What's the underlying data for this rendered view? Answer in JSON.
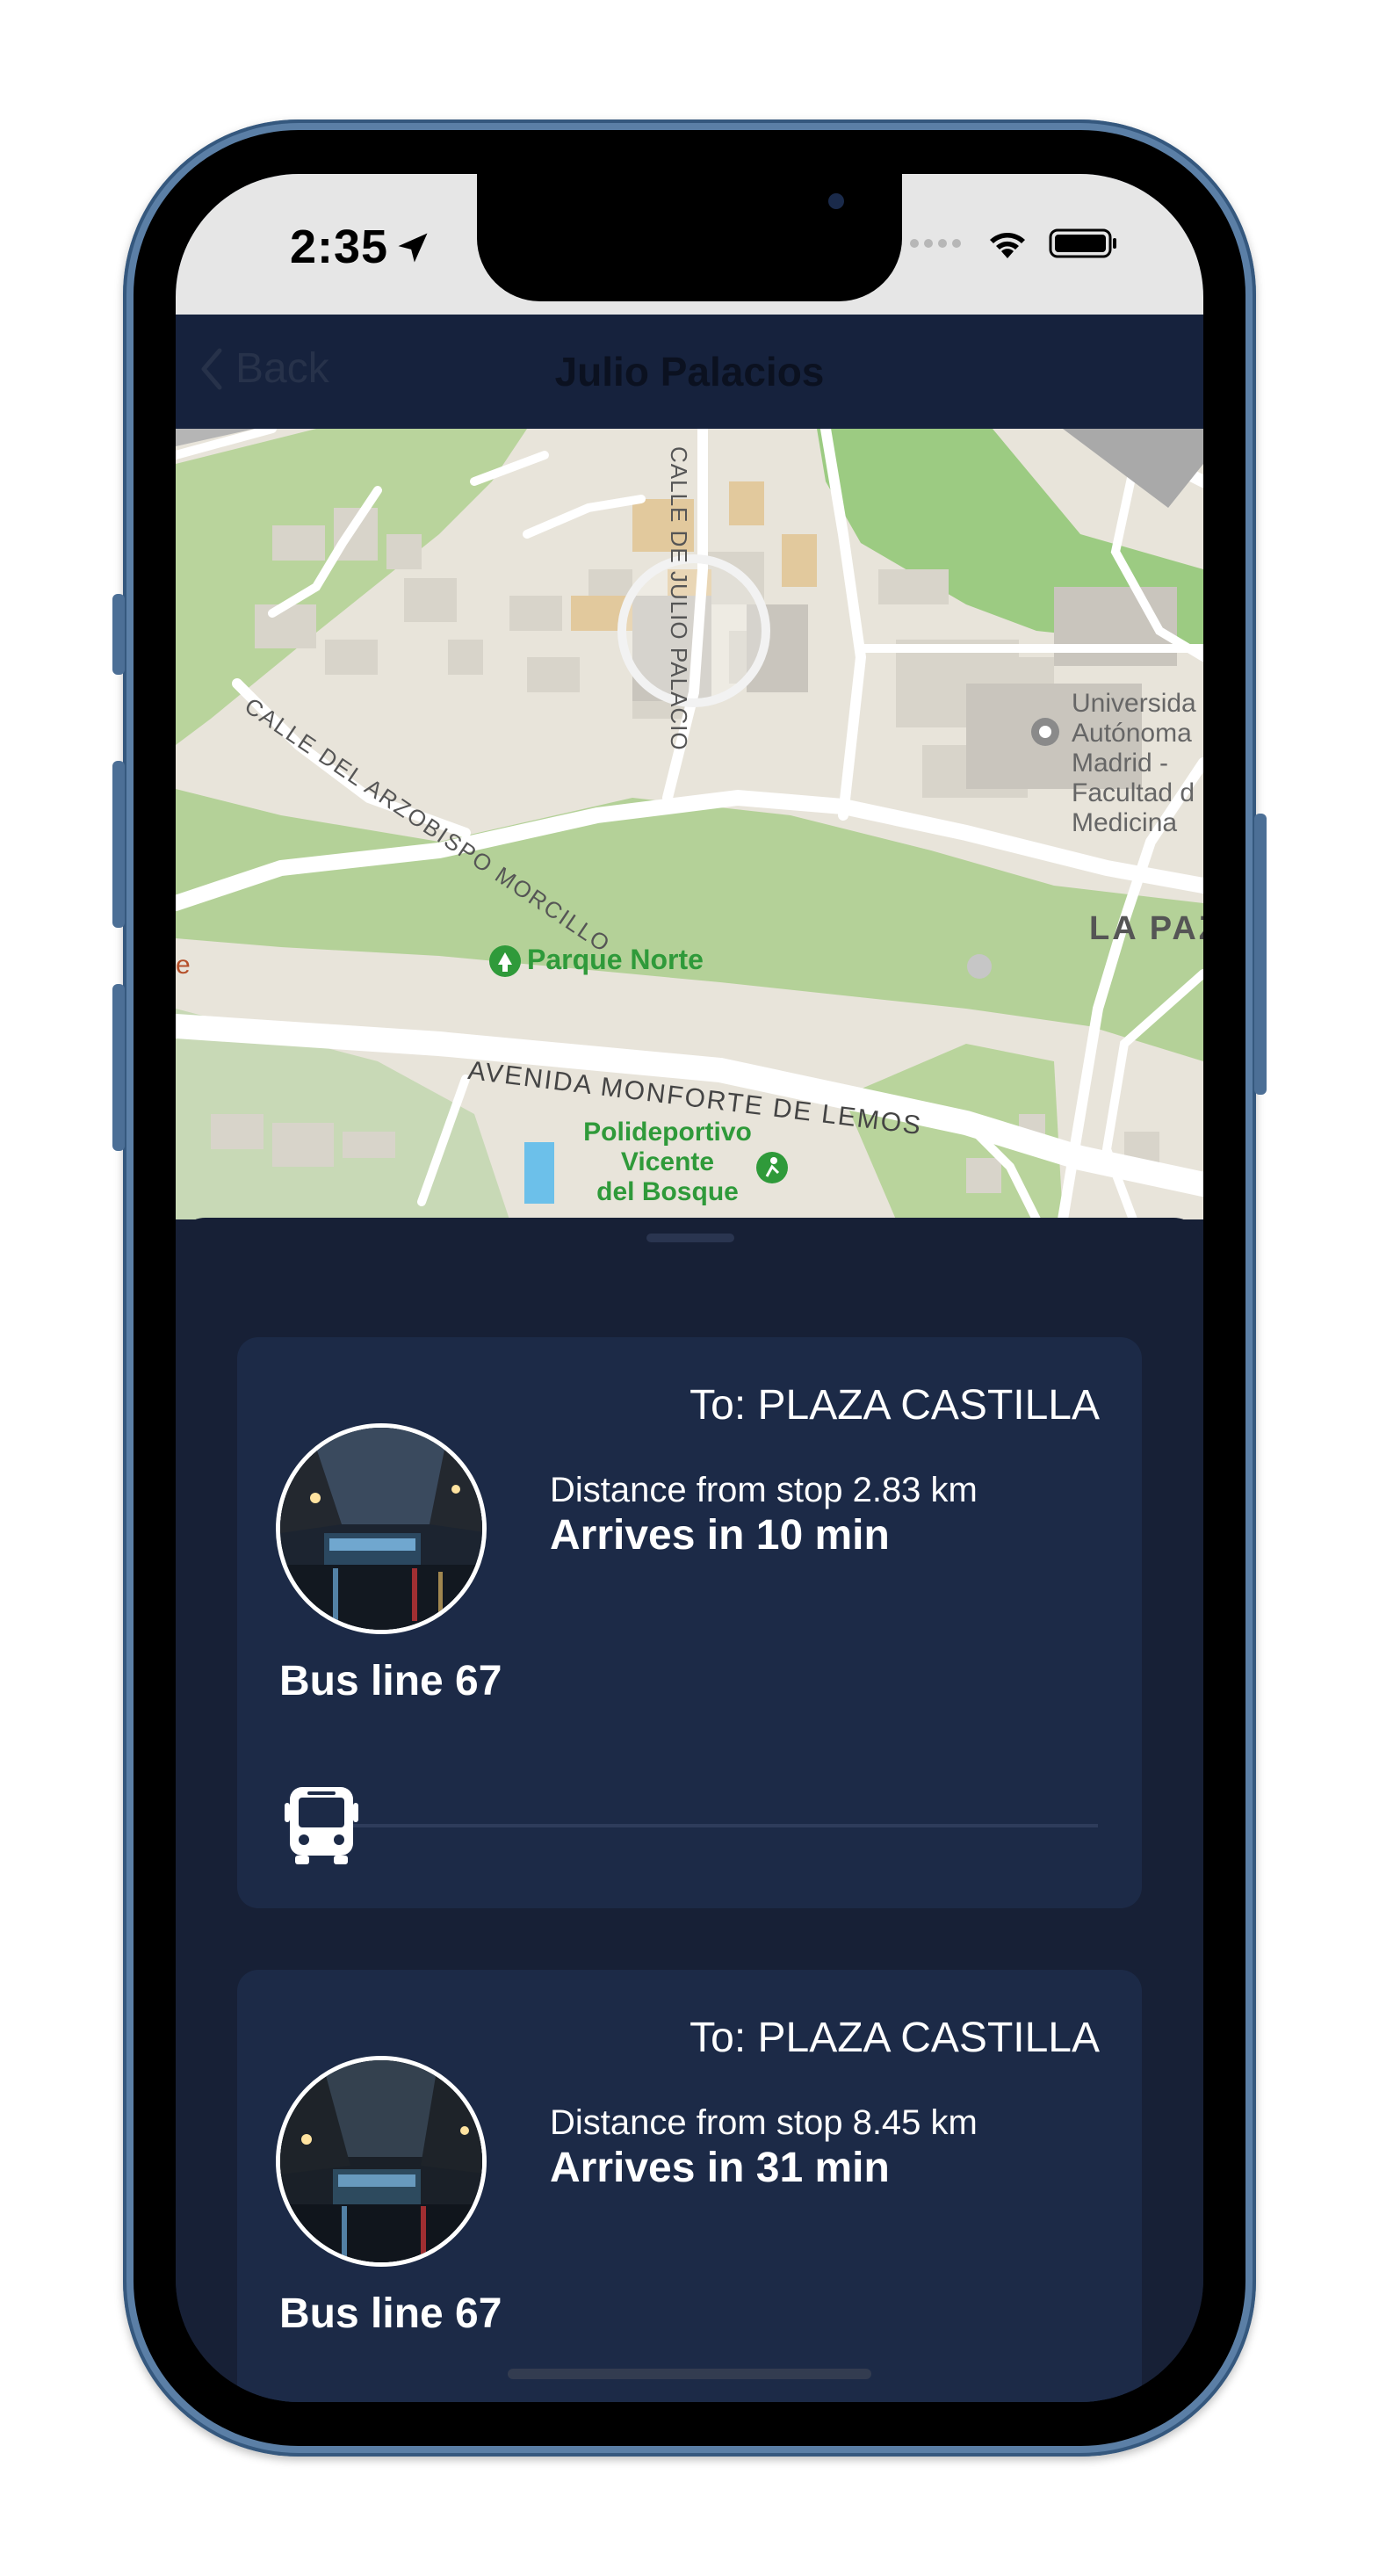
{
  "status_bar": {
    "time": "2:35",
    "icons": [
      "location-arrow-icon",
      "signal-dots-icon",
      "wifi-icon",
      "battery-icon"
    ]
  },
  "nav": {
    "back_label": "Back",
    "title": "Julio Palacios"
  },
  "map": {
    "labels": {
      "street_calle_julio": "CALLE DE JULIO PALACIO",
      "street_arzobispo": "CALLE DEL ARZOBISPO MORCILLO",
      "park": "Parque Norte",
      "avenue": "AVENIDA MONFORTE DE LEMOS",
      "sports_1": "Polideportivo",
      "sports_2": "Vicente",
      "sports_3": "del Bosque",
      "uni_1": "Universida",
      "uni_2": "Autónoma",
      "uni_3": "Madrid -",
      "uni_4": "Facultad d",
      "uni_5": "Medicina",
      "district": "LA PAZ",
      "edge_e": "e"
    }
  },
  "arrivals": [
    {
      "destination": "To: PLAZA CASTILLA",
      "distance": "Distance from stop 2.83 km",
      "arrives": "Arrives in 10 min",
      "line": "Bus line 67",
      "progress": 0.0
    },
    {
      "destination": "To: PLAZA CASTILLA",
      "distance": "Distance from stop 8.45 km",
      "arrives": "Arrives in 31 min",
      "line": "Bus line 67"
    }
  ],
  "colors": {
    "nav_bg": "#16223d",
    "sheet_bg": "#172036",
    "card_bg": "#1c2a47",
    "park_green": "#b6d39a",
    "poi_green": "#2f9a3a"
  }
}
